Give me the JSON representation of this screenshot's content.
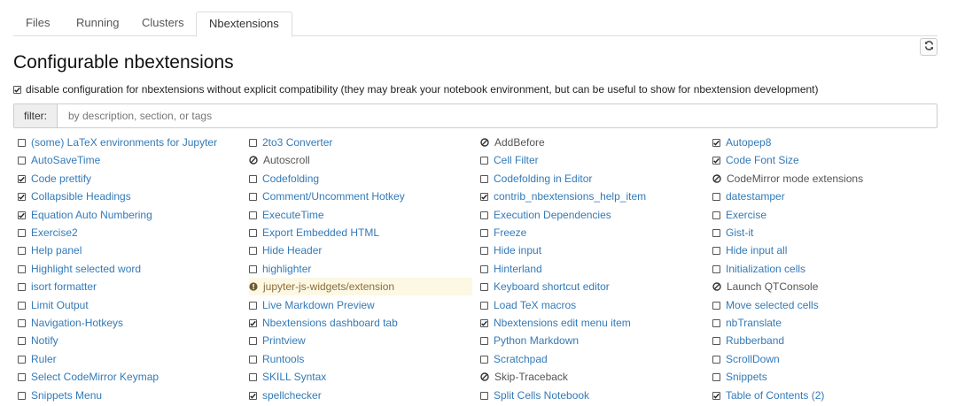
{
  "tabs": [
    "Files",
    "Running",
    "Clusters",
    "Nbextensions"
  ],
  "active_tab": "Nbextensions",
  "page_title": "Configurable nbextensions",
  "compat_checkbox": {
    "checked": true,
    "label": "disable configuration for nbextensions without explicit compatibility (they may break your notebook environment, but can be useful to show for nbextension development)"
  },
  "filter": {
    "label": "filter:",
    "placeholder": "by description, section, or tags",
    "value": ""
  },
  "refresh_icon": "refresh-icon",
  "columns": [
    [
      {
        "label": "(some) LaTeX environments for Jupyter",
        "state": "unchecked"
      },
      {
        "label": "AutoSaveTime",
        "state": "unchecked"
      },
      {
        "label": "Code prettify",
        "state": "checked"
      },
      {
        "label": "Collapsible Headings",
        "state": "checked"
      },
      {
        "label": "Equation Auto Numbering",
        "state": "checked"
      },
      {
        "label": "Exercise2",
        "state": "unchecked"
      },
      {
        "label": "Help panel",
        "state": "unchecked"
      },
      {
        "label": "Highlight selected word",
        "state": "unchecked"
      },
      {
        "label": "isort formatter",
        "state": "unchecked"
      },
      {
        "label": "Limit Output",
        "state": "unchecked"
      },
      {
        "label": "Navigation-Hotkeys",
        "state": "unchecked"
      },
      {
        "label": "Notify",
        "state": "unchecked"
      },
      {
        "label": "Ruler",
        "state": "unchecked"
      },
      {
        "label": "Select CodeMirror Keymap",
        "state": "unchecked"
      },
      {
        "label": "Snippets Menu",
        "state": "unchecked"
      }
    ],
    [
      {
        "label": "2to3 Converter",
        "state": "unchecked"
      },
      {
        "label": "Autoscroll",
        "state": "disabled"
      },
      {
        "label": "Codefolding",
        "state": "unchecked"
      },
      {
        "label": "Comment/Uncomment Hotkey",
        "state": "unchecked"
      },
      {
        "label": "ExecuteTime",
        "state": "unchecked"
      },
      {
        "label": "Export Embedded HTML",
        "state": "unchecked"
      },
      {
        "label": "Hide Header",
        "state": "unchecked"
      },
      {
        "label": "highlighter",
        "state": "unchecked"
      },
      {
        "label": "jupyter-js-widgets/extension",
        "state": "warning"
      },
      {
        "label": "Live Markdown Preview",
        "state": "unchecked"
      },
      {
        "label": "Nbextensions dashboard tab",
        "state": "checked"
      },
      {
        "label": "Printview",
        "state": "unchecked"
      },
      {
        "label": "Runtools",
        "state": "unchecked"
      },
      {
        "label": "SKILL Syntax",
        "state": "unchecked"
      },
      {
        "label": "spellchecker",
        "state": "checked"
      }
    ],
    [
      {
        "label": "AddBefore",
        "state": "disabled"
      },
      {
        "label": "Cell Filter",
        "state": "unchecked"
      },
      {
        "label": "Codefolding in Editor",
        "state": "unchecked"
      },
      {
        "label": "contrib_nbextensions_help_item",
        "state": "checked"
      },
      {
        "label": "Execution Dependencies",
        "state": "unchecked"
      },
      {
        "label": "Freeze",
        "state": "unchecked"
      },
      {
        "label": "Hide input",
        "state": "unchecked"
      },
      {
        "label": "Hinterland",
        "state": "unchecked"
      },
      {
        "label": "Keyboard shortcut editor",
        "state": "unchecked"
      },
      {
        "label": "Load TeX macros",
        "state": "unchecked"
      },
      {
        "label": "Nbextensions edit menu item",
        "state": "checked"
      },
      {
        "label": "Python Markdown",
        "state": "unchecked"
      },
      {
        "label": "Scratchpad",
        "state": "unchecked"
      },
      {
        "label": "Skip-Traceback",
        "state": "disabled"
      },
      {
        "label": "Split Cells Notebook",
        "state": "unchecked"
      }
    ],
    [
      {
        "label": "Autopep8",
        "state": "checked"
      },
      {
        "label": "Code Font Size",
        "state": "checked"
      },
      {
        "label": "CodeMirror mode extensions",
        "state": "disabled"
      },
      {
        "label": "datestamper",
        "state": "unchecked"
      },
      {
        "label": "Exercise",
        "state": "unchecked"
      },
      {
        "label": "Gist-it",
        "state": "unchecked"
      },
      {
        "label": "Hide input all",
        "state": "unchecked"
      },
      {
        "label": "Initialization cells",
        "state": "unchecked"
      },
      {
        "label": "Launch QTConsole",
        "state": "disabled"
      },
      {
        "label": "Move selected cells",
        "state": "unchecked"
      },
      {
        "label": "nbTranslate",
        "state": "unchecked"
      },
      {
        "label": "Rubberband",
        "state": "unchecked"
      },
      {
        "label": "ScrollDown",
        "state": "unchecked"
      },
      {
        "label": "Snippets",
        "state": "unchecked"
      },
      {
        "label": "Table of Contents (2)",
        "state": "checked"
      }
    ]
  ],
  "colors": {
    "link": "#337ab7",
    "warning_bg": "#fcf8e3",
    "warning_text": "#8a6d3b"
  }
}
